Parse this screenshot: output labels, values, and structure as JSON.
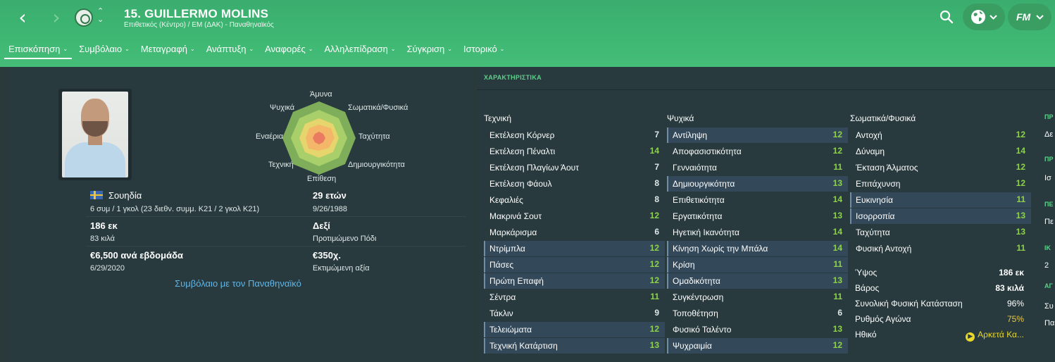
{
  "header": {
    "back_glyph": "‹",
    "forward_glyph": "›",
    "player_name": "15. GUILLERMO MOLINS",
    "player_subtitle": "Επιθετικός (Κέντρο) / ΕΜ (ΔΑΚ) - Παναθηναϊκός",
    "fm_label": "FM"
  },
  "tabs": [
    {
      "label": "Επισκόπηση"
    },
    {
      "label": "Συμβόλαιο"
    },
    {
      "label": "Μεταγραφή"
    },
    {
      "label": "Ανάπτυξη"
    },
    {
      "label": "Αναφορές"
    },
    {
      "label": "Αλληλεπίδραση"
    },
    {
      "label": "Σύγκριση"
    },
    {
      "label": "Ιστορικό"
    }
  ],
  "profile": {
    "nationality": "Σουηδία",
    "caps": "6 συμ / 1 γκολ (23 διεθν. συμμ. Κ21 / 2 γκολ Κ21)",
    "height": "186 εκ",
    "weight": "83 κιλά",
    "wage": "€6,500 ανά εβδομάδα",
    "contract_end": "6/29/2020",
    "age": "29 ετών",
    "dob": "9/26/1988",
    "foot": "Δεξί",
    "foot_label": "Προτιμώμενο Πόδι",
    "value": "€350χ.",
    "value_label": "Εκτιμώμενη αξία",
    "contract_link": "Συμβόλαιο με τον Παναθηναϊκό"
  },
  "radar": {
    "labels": [
      "Άμυνα",
      "Σωματικά/Φυσικά",
      "Ταχύτητα",
      "Δημιουργικότητα",
      "Επίθεση",
      "Τεχνική",
      "Εναέρια",
      "Ψυχικά"
    ]
  },
  "attributes": {
    "title": "ΧΑΡΑΚΤΗΡΙΣΤΙΚΑ",
    "technical_header": "Τεχνική",
    "mental_header": "Ψυχικά",
    "physical_header": "Σωματικά/Φυσικά",
    "technical": [
      {
        "name": "Εκτέλεση Κόρνερ",
        "value": "7",
        "color": "#dfe8e8",
        "hl": false
      },
      {
        "name": "Εκτέλεση Πέναλτι",
        "value": "14",
        "color": "#8fd14f",
        "hl": false
      },
      {
        "name": "Εκτέλεση Πλαγίων Άουτ",
        "value": "7",
        "color": "#dfe8e8",
        "hl": false
      },
      {
        "name": "Εκτέλεση Φάουλ",
        "value": "8",
        "color": "#dfe8e8",
        "hl": false
      },
      {
        "name": "Κεφαλιές",
        "value": "8",
        "color": "#dfe8e8",
        "hl": false
      },
      {
        "name": "Μακρινά Σουτ",
        "value": "12",
        "color": "#8fd14f",
        "hl": false
      },
      {
        "name": "Μαρκάρισμα",
        "value": "6",
        "color": "#dfe8e8",
        "hl": false
      },
      {
        "name": "Ντρίμπλα",
        "value": "12",
        "color": "#8fd14f",
        "hl": true
      },
      {
        "name": "Πάσες",
        "value": "12",
        "color": "#8fd14f",
        "hl": true
      },
      {
        "name": "Πρώτη Επαφή",
        "value": "12",
        "color": "#8fd14f",
        "hl": true
      },
      {
        "name": "Σέντρα",
        "value": "11",
        "color": "#8fd14f",
        "hl": false
      },
      {
        "name": "Τάκλιν",
        "value": "9",
        "color": "#dfe8e8",
        "hl": false
      },
      {
        "name": "Τελειώματα",
        "value": "12",
        "color": "#8fd14f",
        "hl": true
      },
      {
        "name": "Τεχνική Κατάρτιση",
        "value": "13",
        "color": "#8fd14f",
        "hl": true
      }
    ],
    "mental": [
      {
        "name": "Αντίληψη",
        "value": "12",
        "color": "#8fd14f",
        "hl": true
      },
      {
        "name": "Αποφασιστικότητα",
        "value": "12",
        "color": "#8fd14f",
        "hl": false
      },
      {
        "name": "Γενναιότητα",
        "value": "11",
        "color": "#8fd14f",
        "hl": false
      },
      {
        "name": "Δημιουργικότητα",
        "value": "13",
        "color": "#8fd14f",
        "hl": true
      },
      {
        "name": "Επιθετικότητα",
        "value": "14",
        "color": "#8fd14f",
        "hl": false
      },
      {
        "name": "Εργατικότητα",
        "value": "13",
        "color": "#8fd14f",
        "hl": false
      },
      {
        "name": "Ηγετική Ικανότητα",
        "value": "14",
        "color": "#8fd14f",
        "hl": false
      },
      {
        "name": "Κίνηση Χωρίς την Μπάλα",
        "value": "14",
        "color": "#8fd14f",
        "hl": true
      },
      {
        "name": "Κρίση",
        "value": "11",
        "color": "#8fd14f",
        "hl": true
      },
      {
        "name": "Ομαδικότητα",
        "value": "13",
        "color": "#8fd14f",
        "hl": true
      },
      {
        "name": "Συγκέντρωση",
        "value": "11",
        "color": "#8fd14f",
        "hl": false
      },
      {
        "name": "Τοποθέτηση",
        "value": "6",
        "color": "#dfe8e8",
        "hl": false
      },
      {
        "name": "Φυσικό Ταλέντο",
        "value": "13",
        "color": "#8fd14f",
        "hl": false
      },
      {
        "name": "Ψυχραιμία",
        "value": "12",
        "color": "#8fd14f",
        "hl": true
      }
    ],
    "physical": [
      {
        "name": "Αντοχή",
        "value": "12",
        "color": "#8fd14f",
        "hl": false
      },
      {
        "name": "Δύναμη",
        "value": "14",
        "color": "#8fd14f",
        "hl": false
      },
      {
        "name": "Έκταση Άλματος",
        "value": "12",
        "color": "#8fd14f",
        "hl": false
      },
      {
        "name": "Επιτάχυνση",
        "value": "12",
        "color": "#8fd14f",
        "hl": false
      },
      {
        "name": "Ευκινησία",
        "value": "11",
        "color": "#8fd14f",
        "hl": true
      },
      {
        "name": "Ισορροπία",
        "value": "13",
        "color": "#8fd14f",
        "hl": true
      },
      {
        "name": "Ταχύτητα",
        "value": "13",
        "color": "#8fd14f",
        "hl": false
      },
      {
        "name": "Φυσική Αντοχή",
        "value": "11",
        "color": "#8fd14f",
        "hl": false
      }
    ],
    "physical_info": [
      {
        "name": "Ύψος",
        "value": "186 εκ",
        "color": "#ffffff"
      },
      {
        "name": "Βάρος",
        "value": "83 κιλά",
        "color": "#ffffff"
      },
      {
        "name": "Συνολική Φυσική Κατάσταση",
        "value": "96%",
        "color": "#ffffff"
      },
      {
        "name": "Ρυθμός Αγώνα",
        "value": "75%",
        "color": "#e9c84a"
      },
      {
        "name": "Ηθικό",
        "value": "Αρκετά Κα...",
        "color": "#e9d82a"
      }
    ]
  },
  "clipped_column": [
    {
      "text": "ΠΡ",
      "green": true
    },
    {
      "text": "Δε",
      "green": false
    },
    {
      "text": "ΠΡ",
      "green": true
    },
    {
      "text": "Ισ",
      "green": false
    },
    {
      "text": "ΠΕ",
      "green": true
    },
    {
      "text": "Πε",
      "green": false
    },
    {
      "text": "ΙΚ",
      "green": true
    },
    {
      "text": "2",
      "green": false
    },
    {
      "text": "ΑΓ",
      "green": true
    },
    {
      "text": "Συ",
      "green": false
    },
    {
      "text": "Πα",
      "green": false
    }
  ]
}
